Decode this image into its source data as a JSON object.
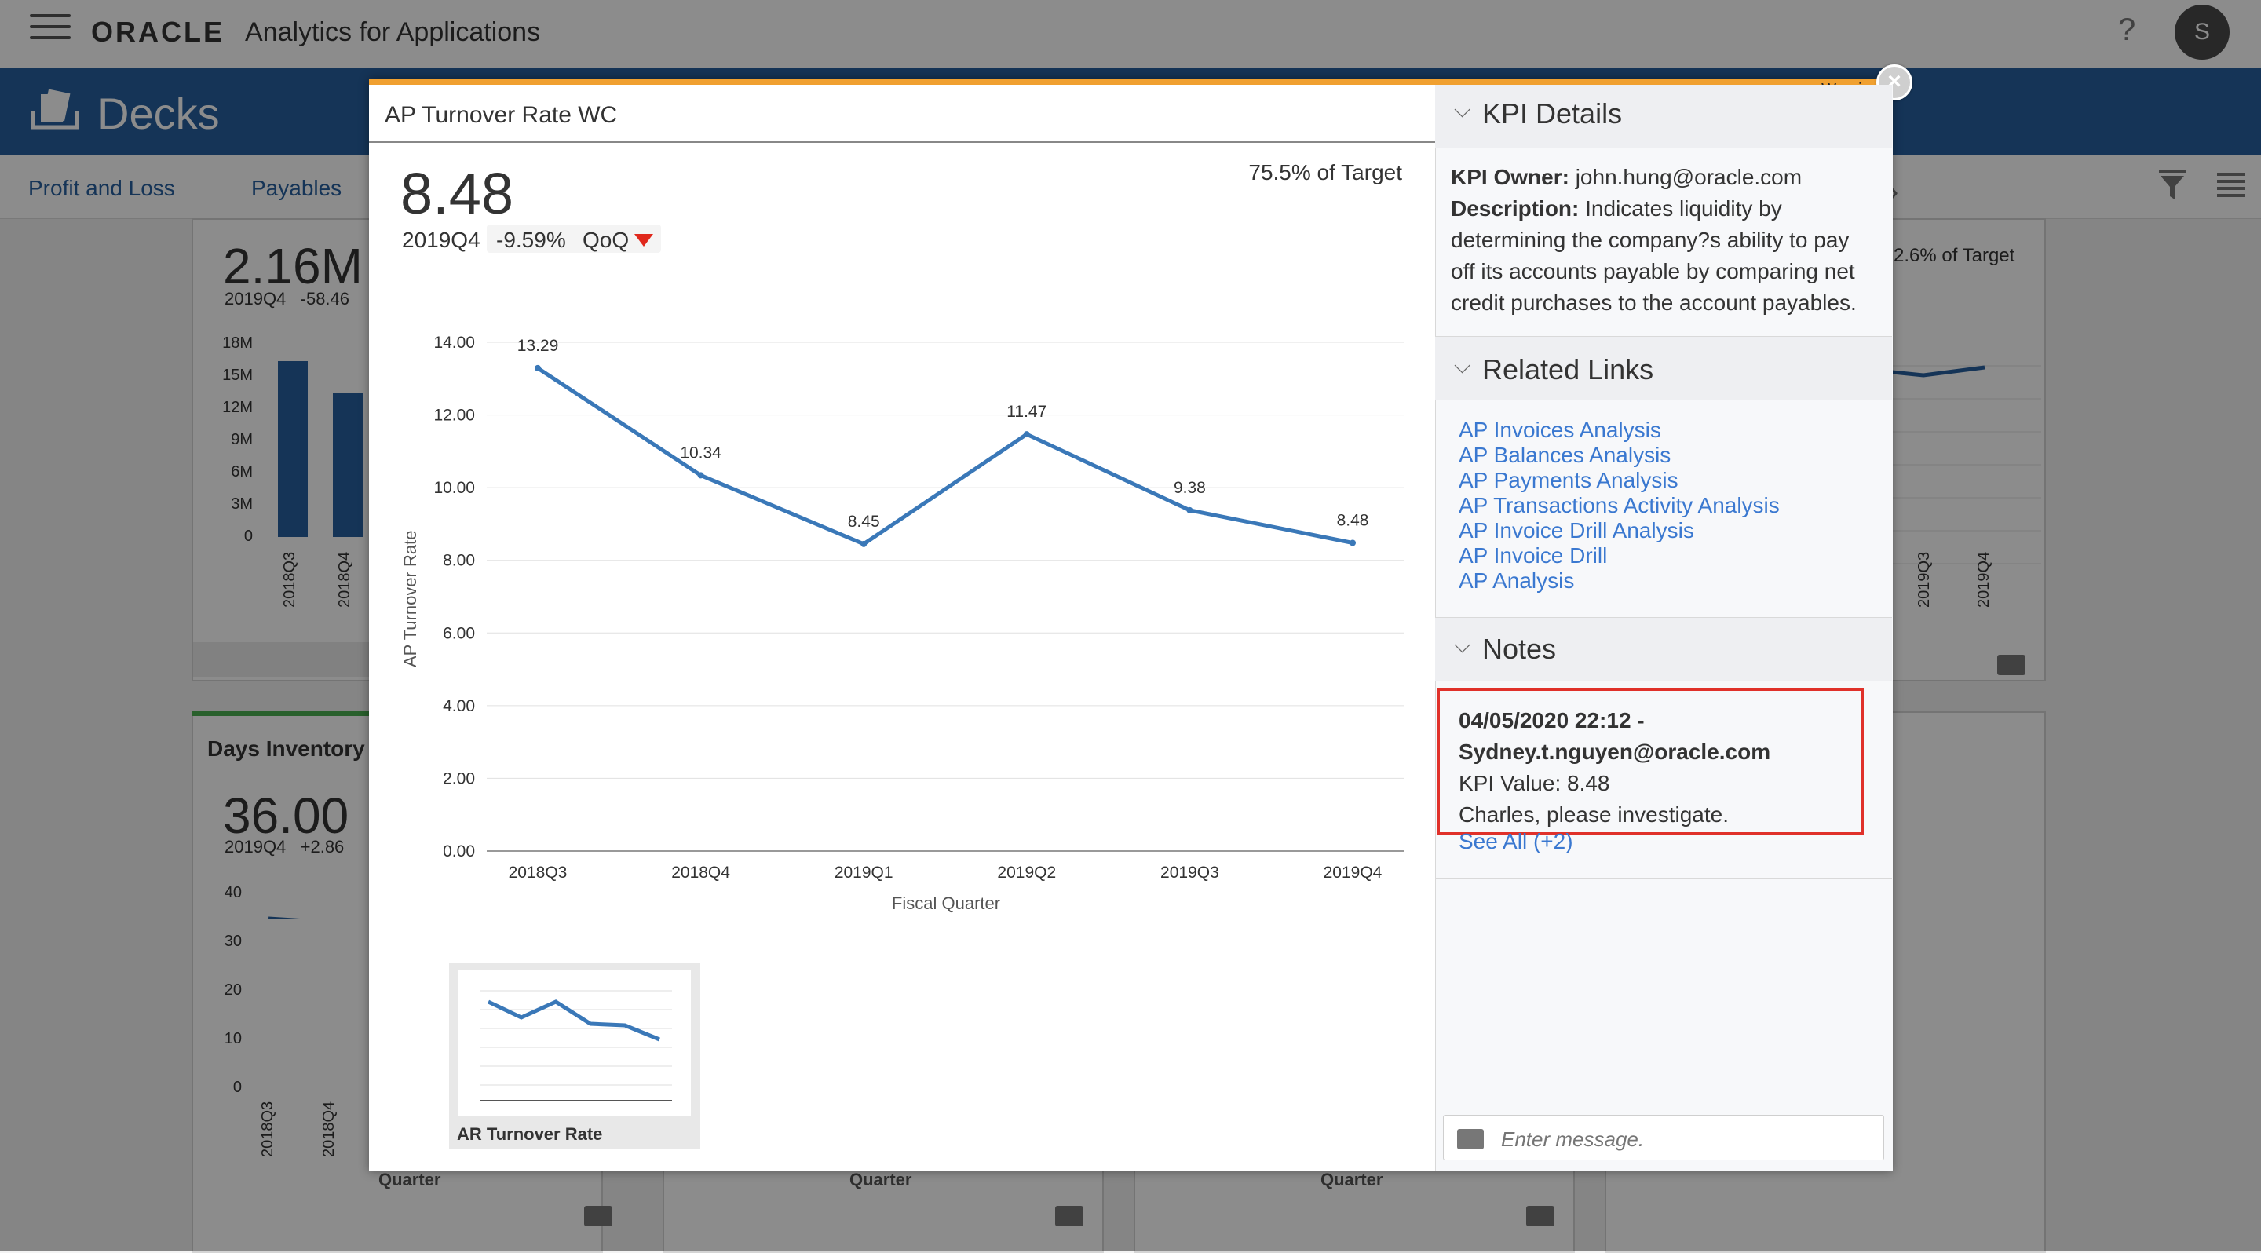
{
  "app": {
    "brand": "ORACLE",
    "title": "Analytics for Applications",
    "help_label": "?",
    "avatar_initial": "S",
    "section_title": "Decks"
  },
  "tabs": [
    "Profit and Loss",
    "Payables"
  ],
  "background_cards": {
    "card1": {
      "value": "2.16M",
      "period_line": "2019Q4   -58.46",
      "yticks": [
        "18M",
        "15M",
        "12M",
        "9M",
        "6M",
        "3M",
        "0"
      ],
      "xticks": [
        "2018Q3",
        "2018Q4"
      ],
      "bars": [
        16.4,
        13.4
      ],
      "bar_max": 18
    },
    "card2": {
      "title": "Days Inventory",
      "value": "36.00",
      "period_line": "2019Q4   +2.86",
      "yticks": [
        "40",
        "30",
        "20",
        "10",
        "0"
      ],
      "xticks": [
        "2018Q3",
        "2018Q4"
      ]
    },
    "card3": {
      "target_fragment": "2.6% of Target",
      "xticks": [
        "2019Q3",
        "2019Q4"
      ]
    },
    "bottom_labels": [
      "Quarter",
      "Quarter",
      "Quarter"
    ]
  },
  "modal": {
    "warning": "Warning",
    "close_symbol": "×",
    "kpi_title": "AP Turnover Rate WC",
    "kpi_value": "8.48",
    "kpi_period": "2019Q4",
    "kpi_change": "-9.59%",
    "kpi_compare": "QoQ",
    "kpi_target": "75.5% of Target",
    "thumbnail_label": "AR Turnover Rate"
  },
  "chart_data": {
    "type": "line",
    "xlabel": "Fiscal Quarter",
    "ylabel": "AP Turnover Rate",
    "categories": [
      "2018Q3",
      "2018Q4",
      "2019Q1",
      "2019Q2",
      "2019Q3",
      "2019Q4"
    ],
    "values": [
      13.29,
      10.34,
      8.45,
      11.47,
      9.38,
      8.48
    ],
    "value_labels": [
      "13.29",
      "10.34",
      "8.45",
      "11.47",
      "9.38",
      "8.48"
    ],
    "yticks": [
      "14.00",
      "12.00",
      "10.00",
      "8.00",
      "6.00",
      "4.00",
      "2.00",
      "0.00"
    ],
    "ylim": [
      0,
      14
    ],
    "grid": true,
    "color": "#3a78b8"
  },
  "panel": {
    "kpi_details": {
      "heading": "KPI Details",
      "owner_label": "KPI Owner:",
      "owner_value": "john.hung@oracle.com",
      "description_label": "Description:",
      "description_value": "Indicates liquidity by determining the company?s ability to pay off its accounts payable by comparing net credit purchases to the account payables."
    },
    "related_links": {
      "heading": "Related Links",
      "links": [
        "AP Invoices Analysis",
        "AP Balances Analysis",
        "AP Payments Analysis",
        "AP Transactions Activity Analysis",
        "AP Invoice Drill Analysis",
        "AP Invoice Drill",
        "AP Analysis"
      ]
    },
    "notes": {
      "heading": "Notes",
      "note_header_1": "04/05/2020 22:12 -",
      "note_header_2": "Sydney.t.nguyen@oracle.com",
      "note_kpi": "KPI Value: 8.48",
      "note_text": "Charles, please investigate.",
      "see_all": "See All (+2)"
    },
    "message": {
      "placeholder": "Enter message."
    }
  }
}
